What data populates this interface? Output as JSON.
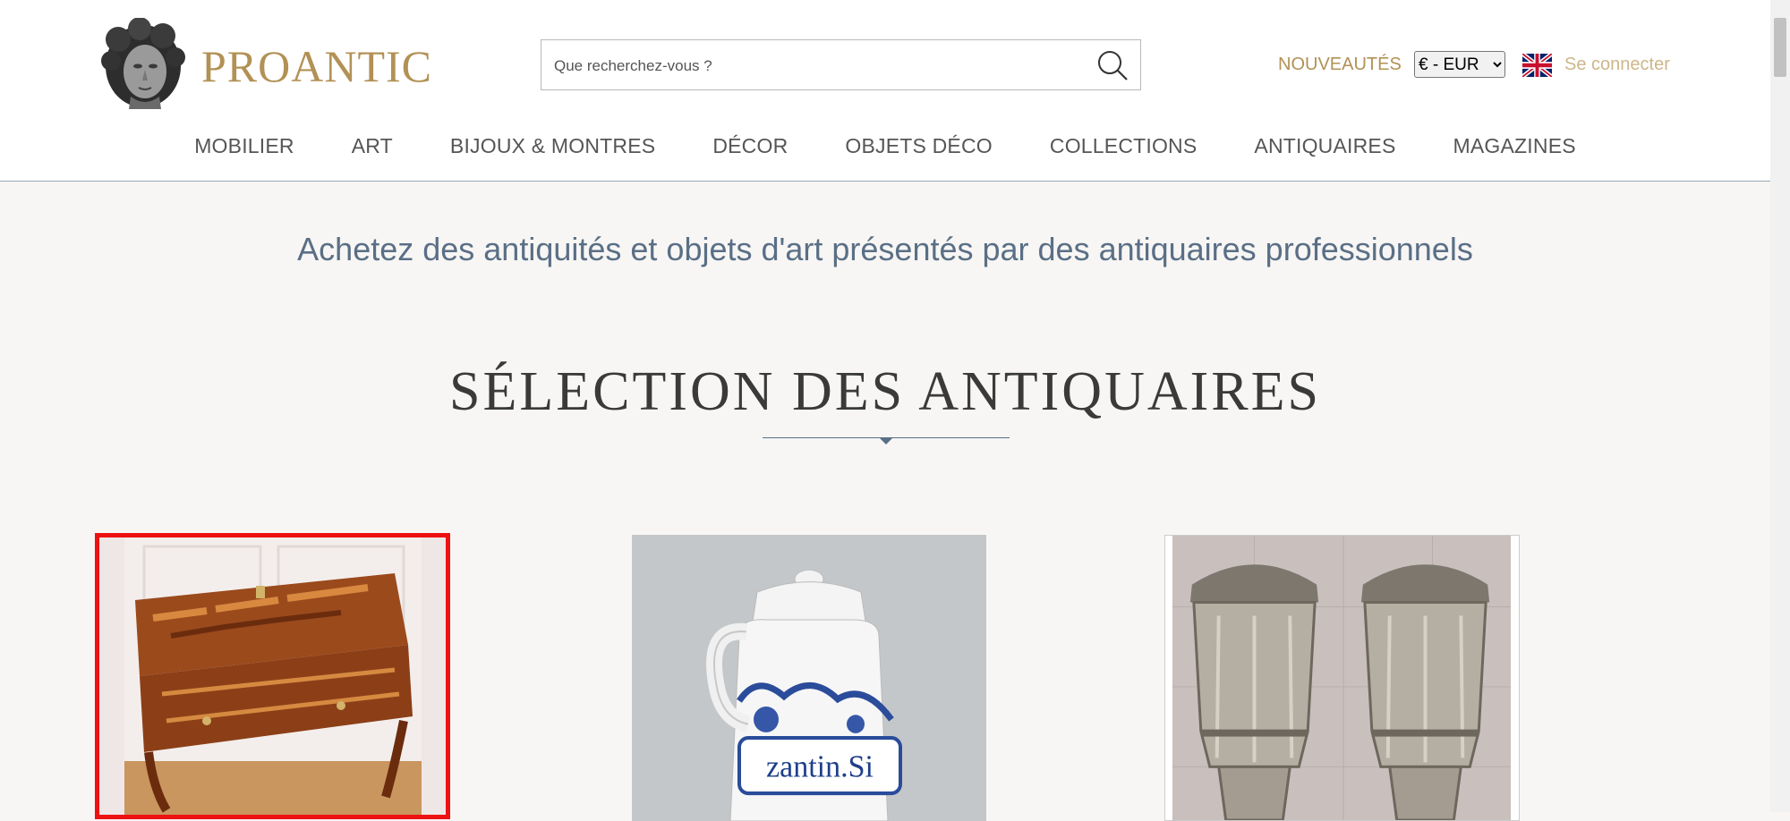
{
  "header": {
    "logo_text": "PROANTIC",
    "search_placeholder": "Que recherchez-vous ?",
    "new_label": "NOUVEAUTÉS",
    "currency_selected": "€ - EUR",
    "login_label": "Se connecter"
  },
  "nav": {
    "items": [
      "MOBILIER",
      "ART",
      "BIJOUX & MONTRES",
      "DÉCOR",
      "OBJETS DÉCO",
      "COLLECTIONS",
      "ANTIQUAIRES",
      "MAGAZINES"
    ]
  },
  "main": {
    "tagline": "Achetez des antiquités et objets d'art présentés par des antiquaires professionnels",
    "section_title": "SÉLECTION DES ANTIQUAIRES",
    "products": [
      {
        "image": "marquetry-secretary-desk"
      },
      {
        "image": "blue-white-apothecary-jug",
        "visible_label": "zantin.Si"
      },
      {
        "image": "art-deco-glass-wall-sconces"
      }
    ]
  },
  "colors": {
    "brand_gold": "#b29155",
    "nav_text": "#555555",
    "accent_blue": "#5a6f86",
    "selection_border": "#ee1111",
    "page_background": "#f7f6f4"
  }
}
